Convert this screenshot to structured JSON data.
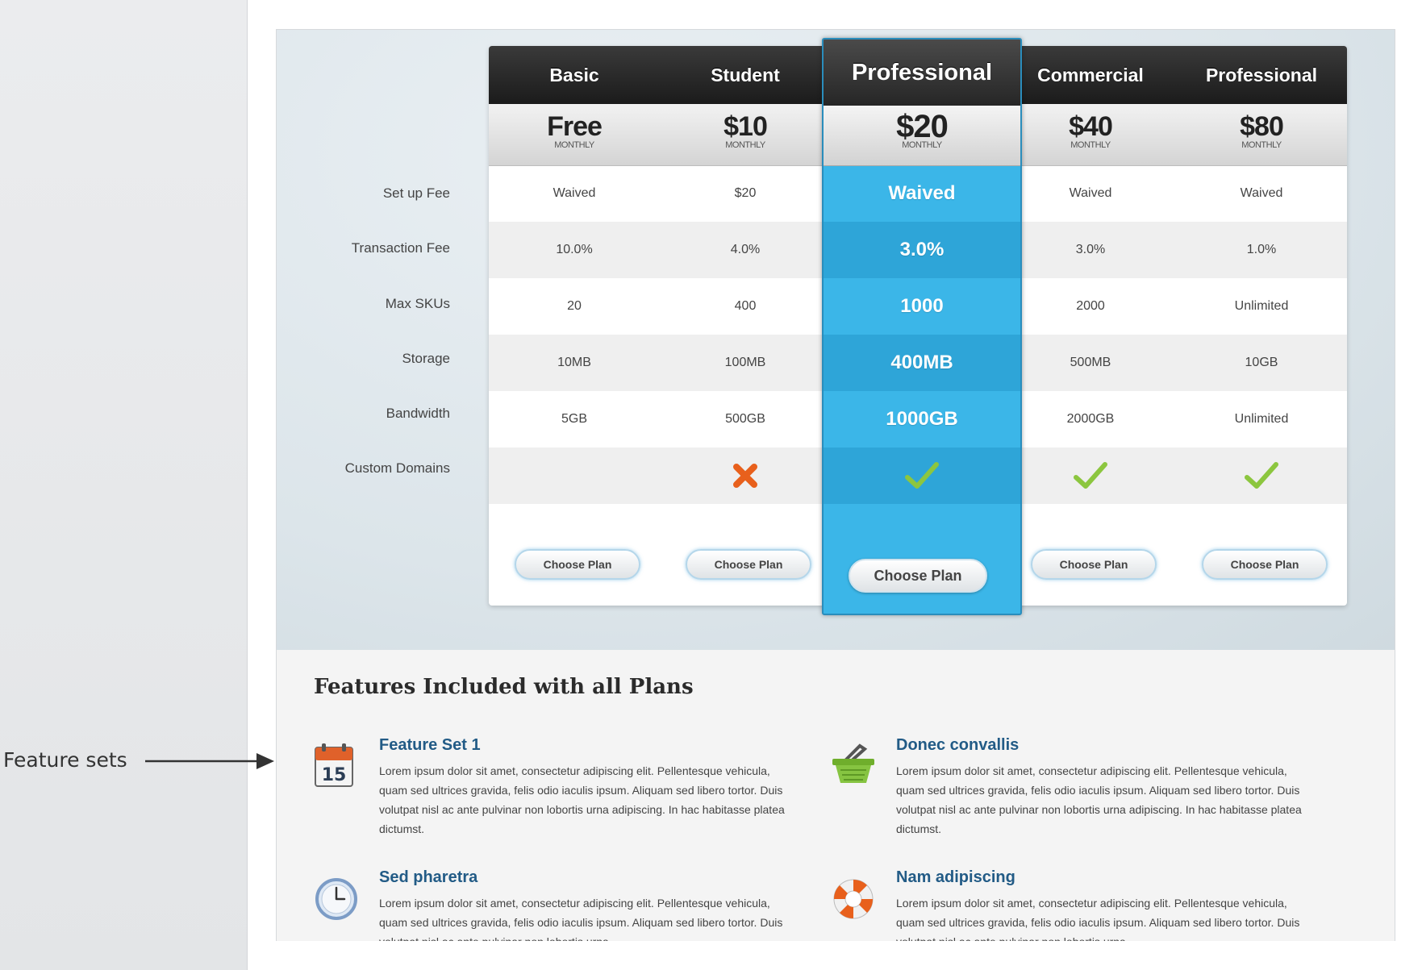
{
  "annotation": {
    "label": "Feature sets"
  },
  "plans": [
    {
      "name": "Basic",
      "price": "Free",
      "period": "MONTHLY",
      "featured": false,
      "values": [
        "Waived",
        "10.0%",
        "20",
        "10MB",
        "5GB"
      ],
      "custom_domains": "none",
      "button": "Choose Plan"
    },
    {
      "name": "Student",
      "price": "$10",
      "period": "MONTHLY",
      "featured": false,
      "values": [
        "$20",
        "4.0%",
        "400",
        "100MB",
        "500GB"
      ],
      "custom_domains": "cross-icon",
      "button": "Choose Plan"
    },
    {
      "name": "Professional",
      "price": "$20",
      "period": "MONTHLY",
      "featured": true,
      "values": [
        "Waived",
        "3.0%",
        "1000",
        "400MB",
        "1000GB"
      ],
      "custom_domains": "check-icon",
      "button": "Choose Plan"
    },
    {
      "name": "Commercial",
      "price": "$40",
      "period": "MONTHLY",
      "featured": false,
      "values": [
        "Waived",
        "3.0%",
        "2000",
        "500MB",
        "2000GB"
      ],
      "custom_domains": "check-icon",
      "button": "Choose Plan"
    },
    {
      "name": "Professional",
      "price": "$80",
      "period": "MONTHLY",
      "featured": false,
      "values": [
        "Waived",
        "1.0%",
        "Unlimited",
        "10GB",
        "Unlimited"
      ],
      "custom_domains": "check-icon",
      "button": "Choose Plan"
    }
  ],
  "row_labels": [
    "Set up Fee",
    "Transaction Fee",
    "Max SKUs",
    "Storage",
    "Bandwidth",
    "Custom Domains"
  ],
  "features_section": {
    "title": "Features Included with all Plans",
    "items": [
      {
        "title": "Feature Set 1",
        "icon": "calendar-icon",
        "icon_text": "15",
        "text": "Lorem ipsum dolor sit amet, consectetur adipiscing elit. Pellentesque vehicula, quam sed ultrices gravida, felis odio iaculis ipsum. Aliquam sed libero tortor. Duis volutpat nisl ac ante pulvinar non lobortis urna adipiscing. In hac habitasse platea dictumst."
      },
      {
        "title": "Donec convallis",
        "icon": "basket-icon",
        "text": "Lorem ipsum dolor sit amet, consectetur adipiscing elit. Pellentesque vehicula, quam sed ultrices gravida, felis odio iaculis ipsum. Aliquam sed libero tortor. Duis volutpat nisl ac ante pulvinar non lobortis urna adipiscing. In hac habitasse platea dictumst."
      },
      {
        "title": "Sed pharetra",
        "icon": "clock-icon",
        "text": "Lorem ipsum dolor sit amet, consectetur adipiscing elit. Pellentesque vehicula, quam sed ultrices gravida, felis odio iaculis ipsum. Aliquam sed libero tortor. Duis volutpat nisl ac ante pulvinar non lobortis urna"
      },
      {
        "title": "Nam adipiscing",
        "icon": "lifebuoy-icon",
        "text": "Lorem ipsum dolor sit amet, consectetur adipiscing elit. Pellentesque vehicula, quam sed ultrices gravida, felis odio iaculis ipsum. Aliquam sed libero tortor. Duis volutpat nisl ac ante pulvinar non lobortis urna"
      }
    ]
  },
  "colors": {
    "featured_accent": "#3bb6e8",
    "featured_stripe": "#2ea5d8",
    "header_dark": "#1b1b1b",
    "feature_title": "#225b86",
    "check_green": "#8cc63f",
    "cross_orange": "#e8601c"
  }
}
